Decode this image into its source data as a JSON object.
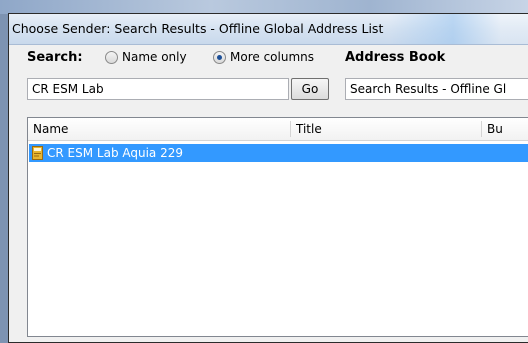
{
  "window": {
    "title": "Choose Sender: Search Results - Offline Global Address List"
  },
  "search": {
    "label": "Search:",
    "option_name_only": "Name only",
    "option_more_columns": "More columns",
    "selected": "More columns",
    "query": "CR ESM Lab",
    "go_label": "Go"
  },
  "address_book": {
    "label": "Address Book",
    "selected": "Search Results - Offline Gl"
  },
  "results": {
    "columns": [
      "Name",
      "Title",
      "Bu"
    ],
    "rows": [
      {
        "name": "CR ESM Lab Aquia 229",
        "selected": true
      }
    ]
  },
  "colors": {
    "selection": "#3399ff",
    "titlebar": "#d5e2f1"
  },
  "icons": {
    "contact": "address-card-icon",
    "radio": "radio-button"
  }
}
